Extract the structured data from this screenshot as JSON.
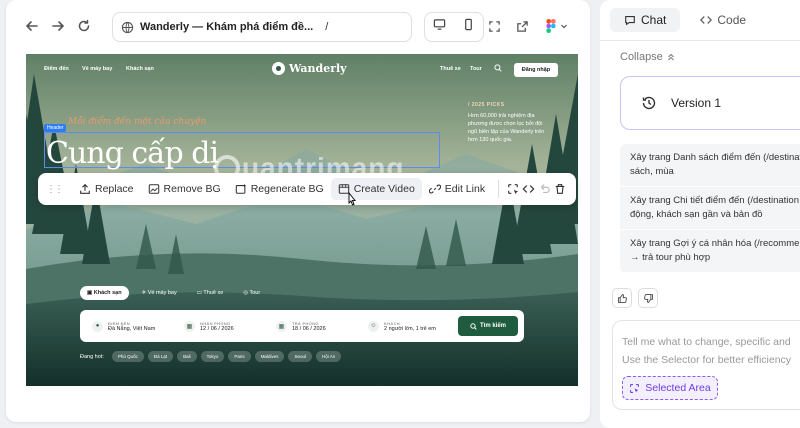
{
  "browser": {
    "site_name": "Wanderly — Khám phá điểm đề...",
    "path": "/"
  },
  "site": {
    "nav_left": [
      "Điểm đến",
      "Vé máy bay",
      "Khách sạn"
    ],
    "logo": "Wanderly",
    "nav_right": [
      "Thuê xe",
      "Tour"
    ],
    "login": "Đăng nhập",
    "hero_tag": "Header",
    "hero_subtitle": "Mỗi điểm đến một câu chuyện",
    "hero_title": "Cung cấp dị",
    "side_label": "/ 2025 PICKS",
    "side_text": "Hơn 60,000 trải nghiệm địa phương được chọn lọc bởi đội ngũ biên tập của Wanderly trên hơn 130 quốc gia.",
    "watermark": "uantrimang",
    "search_tabs": [
      "Khách sạn",
      "Vé máy bay",
      "Thuê xe",
      "Tour"
    ],
    "search_fields": [
      {
        "label": "ĐIỂM ĐẾN",
        "value": "Đà Nẵng, Việt Nam"
      },
      {
        "label": "NHẬN PHÒNG",
        "value": "12 / 06 / 2026"
      },
      {
        "label": "TRẢ PHÒNG",
        "value": "18 / 06 / 2026"
      },
      {
        "label": "KHÁCH",
        "value": "2 người lớn, 1 trẻ em"
      }
    ],
    "search_button": "Tìm kiếm",
    "popular_label": "Đang hot:",
    "popular_chips": [
      "Phú Quốc",
      "Đà Lạt",
      "Bali",
      "Tokyo",
      "Paris",
      "Maldives",
      "Seoul",
      "Hội An"
    ]
  },
  "toolbar": {
    "replace": "Replace",
    "remove_bg": "Remove BG",
    "regenerate_bg": "Regenerate BG",
    "create_video": "Create Video",
    "edit_link": "Edit Link"
  },
  "panel": {
    "tabs": [
      "Chat",
      "Code"
    ],
    "collapse": "Collapse",
    "version": "Version 1",
    "steps": [
      "Xây trang Danh sách điểm đến (/destinations) — lọc theo khu vực, loại hình, sách, mùa",
      "Xây trang Chi tiết điểm đến (/destinations/[slug]) — gallery, mô tả, hoạt động, khách sạn gần và bản đồ",
      "Xây trang Gợi ý cá nhân hóa (/recommendations) — quiz sở thích → trả tour phù hợp"
    ],
    "step_lines": [
      [
        "Xây trang Danh sách điểm đến (/destinat",
        "sách, mùa"
      ],
      [
        "Xây trang Chi tiết điểm đến (/destination",
        "động, khách sạn gần và bản đồ"
      ],
      [
        "Xây trang Gợi ý cá nhân hóa (/recommen",
        "→ trả tour phù hợp"
      ]
    ],
    "composer_line1": "Tell me what to change, specific and",
    "composer_line2": "Use the Selector for better efficiency",
    "selected_area": "Selected Area"
  },
  "colors": {
    "accent": "#1f5b3e",
    "selection": "#8a5cf0",
    "hero_subtitle": "#e89c6d"
  }
}
